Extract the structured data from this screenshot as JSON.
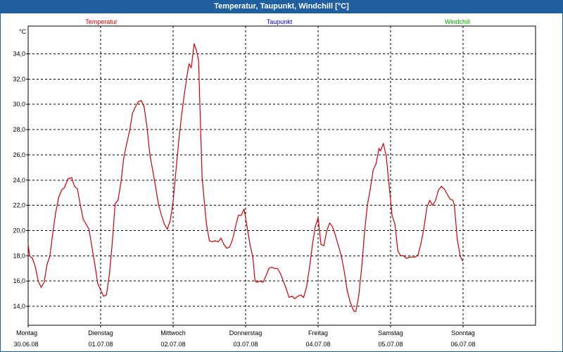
{
  "window": {
    "title": "Temperatur, Taupunkt, Windchill [°C]"
  },
  "colors": {
    "titlebar": "#1f5fa0",
    "temperatur": "#cc0000",
    "taupunkt": "#0000cc",
    "windchill": "#00aa00",
    "grid": "#000000"
  },
  "chart_data": {
    "type": "line",
    "title": "Temperatur, Taupunkt, Windchill [°C]",
    "ylabel": "°C",
    "ylim": [
      12.5,
      36.2
    ],
    "xlim": [
      0,
      7
    ],
    "y_ticks": [
      14.0,
      16.0,
      18.0,
      20.0,
      22.0,
      24.0,
      26.0,
      28.0,
      30.0,
      32.0,
      34.0
    ],
    "y_tick_labels": [
      "14,0",
      "16,0",
      "18,0",
      "20,0",
      "22,0",
      "24,0",
      "26,0",
      "28,0",
      "30,0",
      "32,0",
      "34,0"
    ],
    "x_day_labels": [
      "Montag",
      "Dienstag",
      "Mittwoch",
      "Donnerstag",
      "Freitag",
      "Samstag",
      "Sonntag"
    ],
    "x_date_labels": [
      "30.06.08",
      "01.07.08",
      "02.07.08",
      "03.07.08",
      "04.07.08",
      "05.07.08",
      "06.07.08"
    ],
    "grid": true,
    "legend": [
      "Temperatur",
      "Taupunkt",
      "Windchill"
    ],
    "legend_placement": "top",
    "series": [
      {
        "name": "Temperatur",
        "points": [
          [
            0.0,
            18.9
          ],
          [
            0.02,
            18.0
          ],
          [
            0.06,
            17.8
          ],
          [
            0.1,
            17.1
          ],
          [
            0.14,
            16.0
          ],
          [
            0.18,
            15.5
          ],
          [
            0.22,
            15.9
          ],
          [
            0.26,
            17.3
          ],
          [
            0.3,
            18.0
          ],
          [
            0.34,
            19.8
          ],
          [
            0.38,
            21.4
          ],
          [
            0.42,
            22.6
          ],
          [
            0.46,
            23.2
          ],
          [
            0.5,
            23.4
          ],
          [
            0.55,
            24.1
          ],
          [
            0.6,
            24.2
          ],
          [
            0.64,
            23.5
          ],
          [
            0.68,
            23.3
          ],
          [
            0.72,
            22.0
          ],
          [
            0.76,
            20.9
          ],
          [
            0.8,
            20.5
          ],
          [
            0.84,
            20.1
          ],
          [
            0.88,
            18.7
          ],
          [
            0.92,
            17.3
          ],
          [
            0.96,
            15.8
          ],
          [
            1.0,
            15.3
          ],
          [
            1.04,
            14.8
          ],
          [
            1.08,
            14.9
          ],
          [
            1.12,
            16.5
          ],
          [
            1.16,
            19.0
          ],
          [
            1.2,
            22.1
          ],
          [
            1.24,
            22.4
          ],
          [
            1.28,
            23.8
          ],
          [
            1.32,
            25.8
          ],
          [
            1.36,
            26.9
          ],
          [
            1.4,
            27.9
          ],
          [
            1.44,
            29.3
          ],
          [
            1.48,
            29.8
          ],
          [
            1.52,
            30.2
          ],
          [
            1.56,
            30.3
          ],
          [
            1.6,
            29.8
          ],
          [
            1.64,
            28.2
          ],
          [
            1.68,
            26.0
          ],
          [
            1.72,
            24.7
          ],
          [
            1.76,
            23.4
          ],
          [
            1.8,
            22.0
          ],
          [
            1.84,
            21.2
          ],
          [
            1.88,
            20.5
          ],
          [
            1.92,
            20.1
          ],
          [
            1.96,
            20.8
          ],
          [
            2.0,
            22.3
          ],
          [
            2.04,
            24.8
          ],
          [
            2.08,
            27.2
          ],
          [
            2.12,
            29.3
          ],
          [
            2.16,
            31.0
          ],
          [
            2.2,
            32.6
          ],
          [
            2.22,
            33.2
          ],
          [
            2.25,
            32.9
          ],
          [
            2.29,
            34.8
          ],
          [
            2.32,
            34.3
          ],
          [
            2.35,
            33.5
          ],
          [
            2.38,
            28.0
          ],
          [
            2.4,
            24.2
          ],
          [
            2.43,
            22.3
          ],
          [
            2.46,
            20.5
          ],
          [
            2.5,
            19.2
          ],
          [
            2.54,
            19.1
          ],
          [
            2.58,
            19.2
          ],
          [
            2.62,
            19.1
          ],
          [
            2.66,
            19.4
          ],
          [
            2.7,
            18.9
          ],
          [
            2.74,
            18.6
          ],
          [
            2.78,
            18.7
          ],
          [
            2.82,
            19.3
          ],
          [
            2.86,
            20.3
          ],
          [
            2.9,
            21.2
          ],
          [
            2.94,
            21.2
          ],
          [
            2.98,
            21.7
          ],
          [
            3.02,
            20.3
          ],
          [
            3.06,
            18.9
          ],
          [
            3.1,
            17.9
          ],
          [
            3.13,
            16.0
          ],
          [
            3.16,
            15.9
          ],
          [
            3.2,
            16.0
          ],
          [
            3.24,
            15.9
          ],
          [
            3.28,
            16.4
          ],
          [
            3.32,
            17.0
          ],
          [
            3.36,
            17.1
          ],
          [
            3.4,
            17.0
          ],
          [
            3.44,
            17.0
          ],
          [
            3.48,
            16.6
          ],
          [
            3.52,
            16.0
          ],
          [
            3.56,
            15.4
          ],
          [
            3.6,
            14.7
          ],
          [
            3.64,
            14.8
          ],
          [
            3.68,
            14.6
          ],
          [
            3.72,
            14.8
          ],
          [
            3.76,
            14.9
          ],
          [
            3.8,
            14.7
          ],
          [
            3.84,
            15.5
          ],
          [
            3.88,
            17.0
          ],
          [
            3.92,
            18.8
          ],
          [
            3.96,
            20.3
          ],
          [
            4.0,
            21.0
          ],
          [
            4.04,
            18.9
          ],
          [
            4.08,
            18.8
          ],
          [
            4.12,
            20.0
          ],
          [
            4.16,
            20.6
          ],
          [
            4.2,
            20.3
          ],
          [
            4.24,
            19.6
          ],
          [
            4.28,
            18.8
          ],
          [
            4.32,
            18.0
          ],
          [
            4.36,
            16.8
          ],
          [
            4.4,
            15.3
          ],
          [
            4.44,
            14.4
          ],
          [
            4.48,
            13.8
          ],
          [
            4.5,
            13.6
          ],
          [
            4.52,
            13.6
          ],
          [
            4.56,
            14.8
          ],
          [
            4.6,
            17.0
          ],
          [
            4.64,
            19.8
          ],
          [
            4.68,
            22.0
          ],
          [
            4.72,
            23.3
          ],
          [
            4.76,
            24.8
          ],
          [
            4.8,
            25.3
          ],
          [
            4.84,
            26.5
          ],
          [
            4.86,
            26.3
          ],
          [
            4.9,
            26.9
          ],
          [
            4.94,
            25.9
          ],
          [
            4.98,
            23.6
          ],
          [
            5.02,
            21.2
          ],
          [
            5.06,
            20.5
          ],
          [
            5.1,
            18.4
          ],
          [
            5.14,
            18.0
          ],
          [
            5.18,
            18.0
          ],
          [
            5.22,
            17.8
          ],
          [
            5.26,
            17.9
          ],
          [
            5.3,
            17.9
          ],
          [
            5.34,
            17.9
          ],
          [
            5.38,
            18.1
          ],
          [
            5.42,
            19.0
          ],
          [
            5.46,
            20.2
          ],
          [
            5.5,
            21.8
          ],
          [
            5.54,
            22.4
          ],
          [
            5.58,
            22.0
          ],
          [
            5.62,
            22.4
          ],
          [
            5.66,
            23.2
          ],
          [
            5.7,
            23.5
          ],
          [
            5.74,
            23.3
          ],
          [
            5.78,
            22.9
          ],
          [
            5.82,
            22.5
          ],
          [
            5.86,
            22.4
          ],
          [
            5.88,
            22.0
          ],
          [
            5.92,
            19.3
          ],
          [
            5.96,
            18.0
          ],
          [
            5.99,
            17.6
          ]
        ]
      }
    ]
  }
}
